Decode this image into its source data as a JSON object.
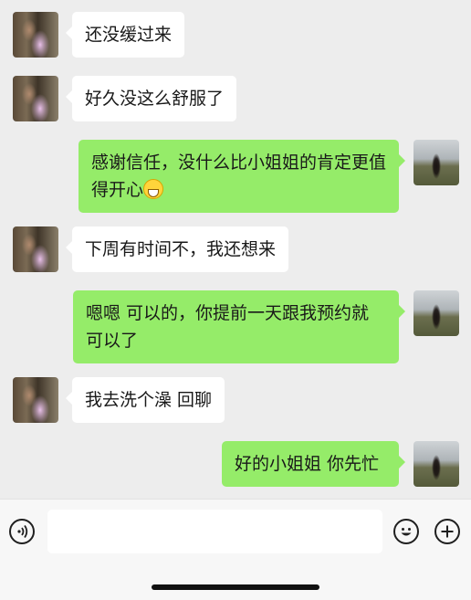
{
  "messages": [
    {
      "side": "left",
      "text": "还没缓过来"
    },
    {
      "side": "left",
      "text": "好久没这么舒服了"
    },
    {
      "side": "right",
      "text": "感谢信任，没什么比小姐姐的肯定更值得开心",
      "emoji": "grinning-face-emoji"
    },
    {
      "side": "left",
      "text": "下周有时间不，我还想来"
    },
    {
      "side": "right",
      "text": "嗯嗯 可以的，你提前一天跟我预约就可以了"
    },
    {
      "side": "left",
      "text": "我去洗个澡 回聊"
    },
    {
      "side": "right",
      "text": "好的小姐姐 你先忙"
    }
  ],
  "input_bar": {
    "text_value": "",
    "icons": [
      "voice-icon",
      "emoji-icon",
      "plus-icon"
    ]
  },
  "colors": {
    "background": "#ededed",
    "incoming_bubble": "#ffffff",
    "outgoing_bubble": "#95ec69",
    "input_bar": "#f7f7f7"
  }
}
